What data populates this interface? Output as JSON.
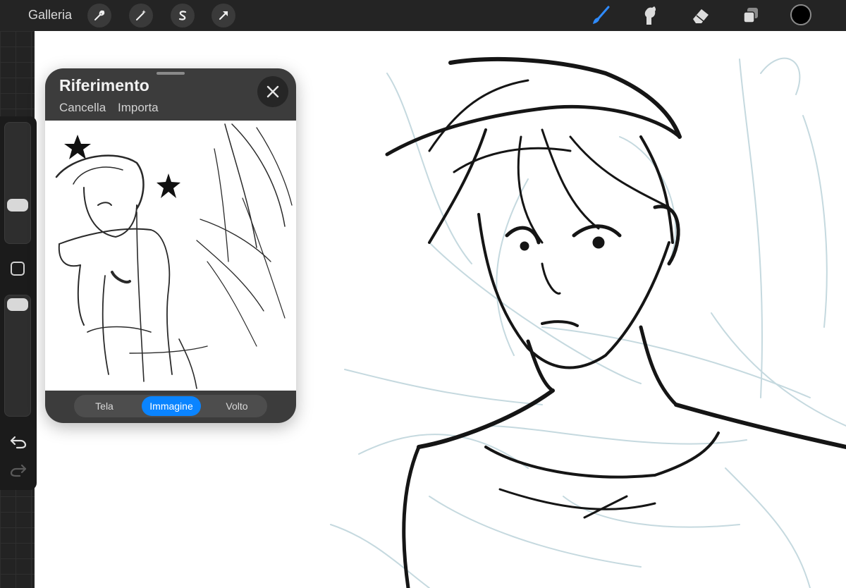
{
  "toolbar": {
    "gallery_label": "Galleria",
    "left_tools": [
      "wrench-icon",
      "magic-wand-icon",
      "selection-icon",
      "transform-arrow-icon"
    ],
    "right_tools": [
      "brush-icon",
      "smudge-icon",
      "eraser-icon",
      "layers-icon"
    ],
    "active_tool": "brush-icon",
    "active_tool_color": "#2f8bff",
    "current_color": "#000000"
  },
  "sidebar": {
    "controls": [
      "brush-size-slider",
      "modify-button",
      "opacity-slider",
      "undo-icon",
      "redo-icon"
    ]
  },
  "reference": {
    "title": "Riferimento",
    "actions": [
      "Cancella",
      "Importa"
    ],
    "segments": [
      "Tela",
      "Immagine",
      "Volto"
    ],
    "selected_segment": "Immagine",
    "accent_color": "#0a84ff"
  }
}
